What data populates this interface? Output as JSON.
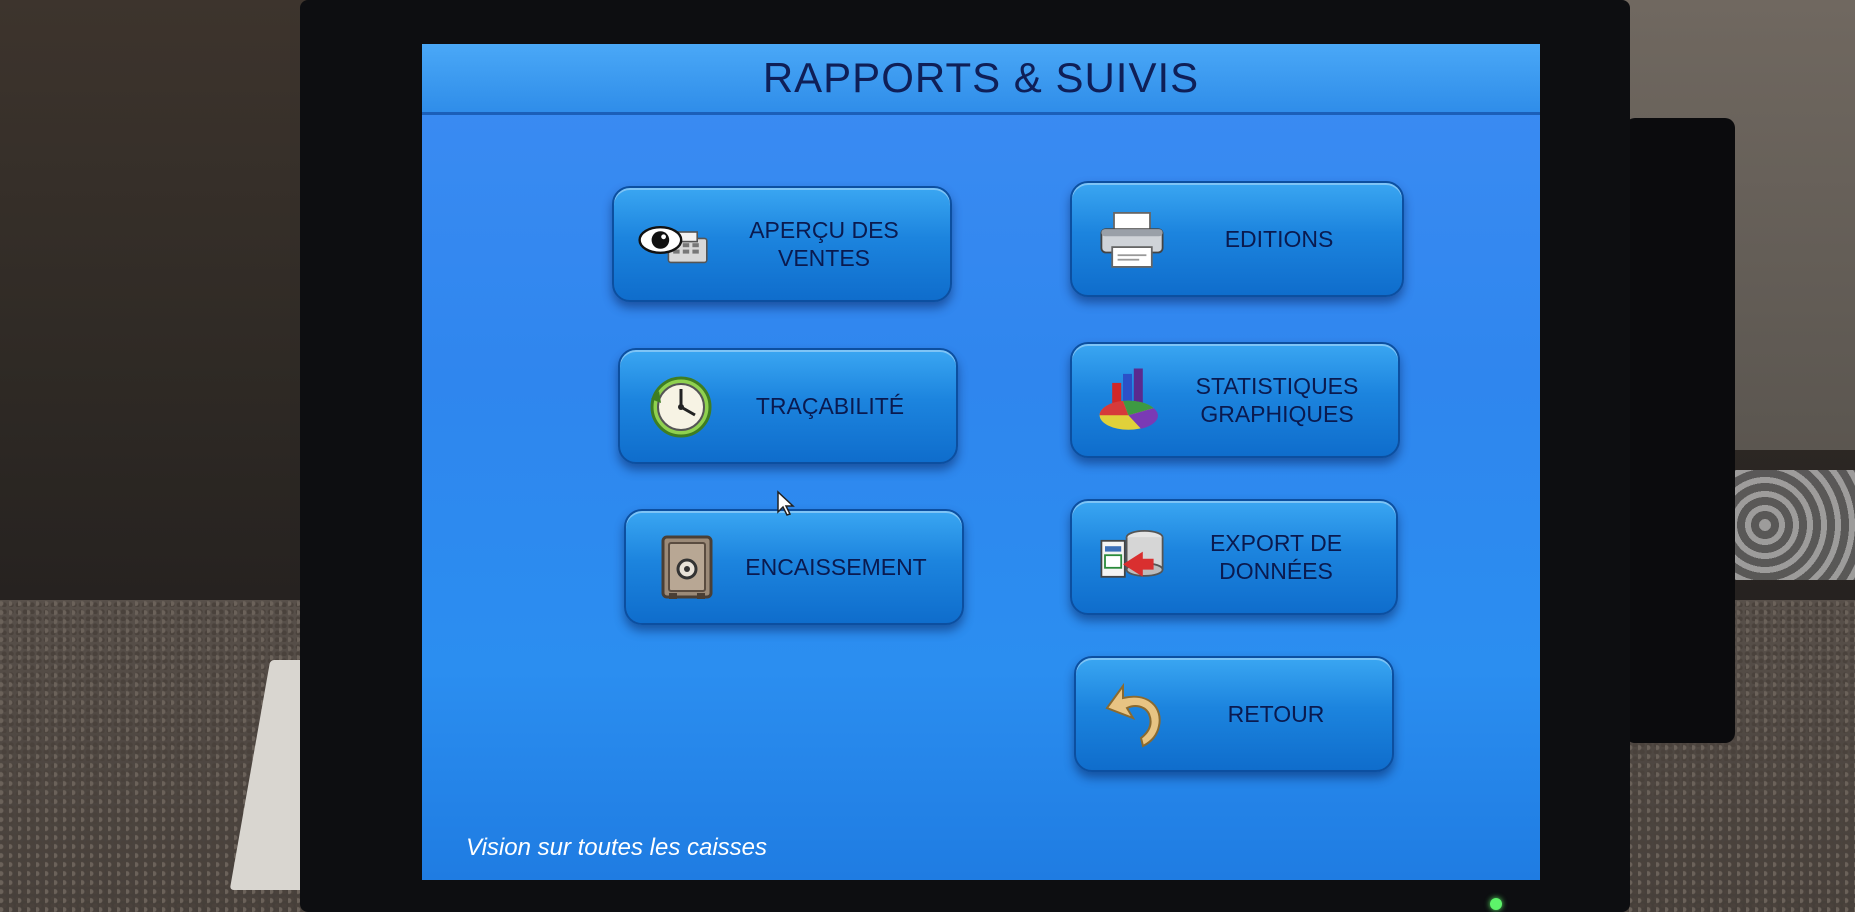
{
  "screen": {
    "title": "RAPPORTS & SUIVIS",
    "footer": "Vision sur toutes les caisses"
  },
  "buttons": {
    "apercu": {
      "label": "APERÇU DES\nVENTES",
      "icon": "eye-register-icon"
    },
    "editions": {
      "label": "EDITIONS",
      "icon": "printer-icon"
    },
    "tracabilite": {
      "label": "TRAÇABILITÉ",
      "icon": "clock-icon"
    },
    "statistiques": {
      "label": "STATISTIQUES\nGRAPHIQUES",
      "icon": "chart-icon"
    },
    "encaissement": {
      "label": "ENCAISSEMENT",
      "icon": "safe-icon"
    },
    "export": {
      "label": "EXPORT DE\nDONNÉES",
      "icon": "database-export-icon"
    },
    "retour": {
      "label": "RETOUR",
      "icon": "back-arrow-icon"
    }
  },
  "colors": {
    "screen_bg": "#2f86ee",
    "button_text": "#0a1a4f",
    "title_text": "#0f1f57",
    "footer_text": "#ffffff"
  }
}
